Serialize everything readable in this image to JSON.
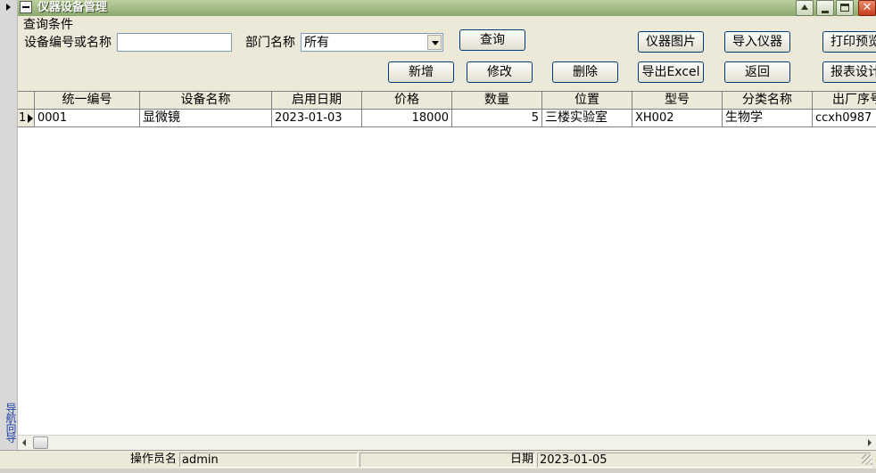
{
  "window": {
    "title": "仪器设备管理"
  },
  "nav": {
    "label": "导航向导"
  },
  "query": {
    "section_label": "查询条件",
    "code_name_label": "设备编号或名称",
    "code_name_value": "",
    "department_label": "部门名称",
    "department_value": "所有"
  },
  "buttons": {
    "query": "查询",
    "device_images": "仪器图片",
    "import_devices": "导入仪器",
    "print_preview": "打印预览",
    "add": "新增",
    "edit": "修改",
    "delete": "删除",
    "export_excel": "导出Excel",
    "back": "返回",
    "report_design": "报表设计"
  },
  "table": {
    "columns": [
      "统一编号",
      "设备名称",
      "启用日期",
      "价格",
      "数量",
      "位置",
      "型号",
      "分类名称",
      "出厂序号"
    ],
    "rows": [
      {
        "row_number": "1",
        "cells": [
          "0001",
          "显微镜",
          "2023-01-03",
          "18000",
          "5",
          "三楼实验室",
          "XH002",
          "生物学",
          "ccxh0987"
        ]
      }
    ]
  },
  "status": {
    "operator_label": "操作员名",
    "operator_value": "admin",
    "date_label": "日期",
    "date_value": "2023-01-05"
  }
}
